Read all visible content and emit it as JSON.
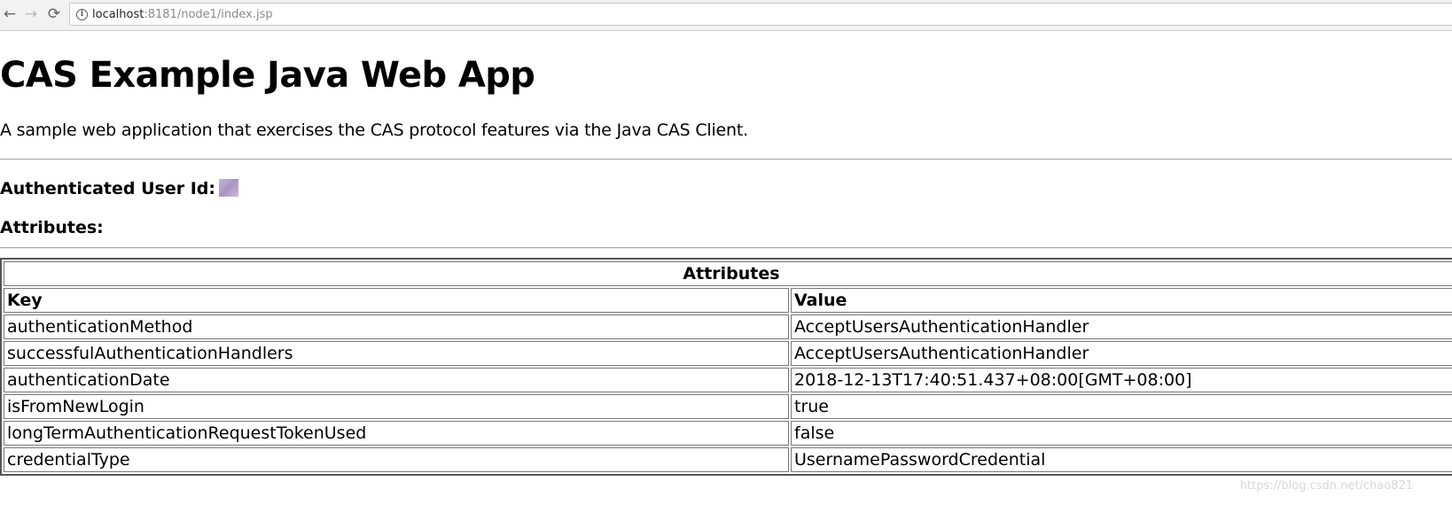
{
  "browser": {
    "url_host": "localhost",
    "url_rest": ":8181/node1/index.jsp"
  },
  "page": {
    "title": "CAS Example Java Web App",
    "description": "A sample web application that exercises the CAS protocol features via the Java CAS Client.",
    "authenticated_label": "Authenticated User Id:",
    "attributes_heading": "Attributes:"
  },
  "table": {
    "caption": "Attributes",
    "headers": [
      "Key",
      "Value"
    ],
    "rows": [
      {
        "key": "authenticationMethod",
        "value": "AcceptUsersAuthenticationHandler"
      },
      {
        "key": "successfulAuthenticationHandlers",
        "value": "AcceptUsersAuthenticationHandler"
      },
      {
        "key": "authenticationDate",
        "value": "2018-12-13T17:40:51.437+08:00[GMT+08:00]"
      },
      {
        "key": "isFromNewLogin",
        "value": "true"
      },
      {
        "key": "longTermAuthenticationRequestTokenUsed",
        "value": "false"
      },
      {
        "key": "credentialType",
        "value": "UsernamePasswordCredential"
      }
    ]
  },
  "watermark": "https://blog.csdn.net/chao821"
}
